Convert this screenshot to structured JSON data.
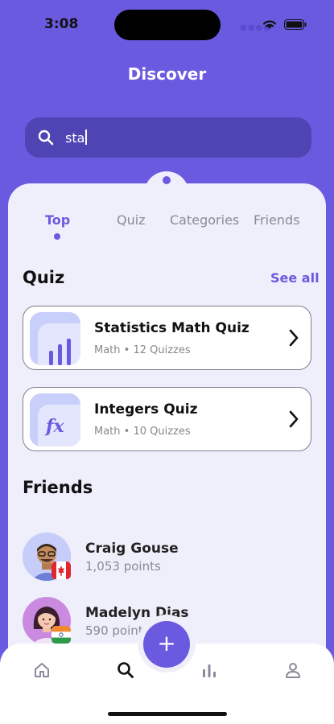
{
  "status": {
    "time": "3:08"
  },
  "header": {
    "title": "Discover"
  },
  "search": {
    "value": "sta"
  },
  "tabs": [
    {
      "label": "Top",
      "active": true
    },
    {
      "label": "Quiz",
      "active": false
    },
    {
      "label": "Categories",
      "active": false
    },
    {
      "label": "Friends",
      "active": false
    }
  ],
  "quiz_section": {
    "title": "Quiz",
    "see_all": "See all",
    "items": [
      {
        "name": "Statistics Math Quiz",
        "meta": "Math • 12 Quizzes",
        "icon": "bar-chart-icon"
      },
      {
        "name": "Integers Quiz",
        "meta": "Math • 10 Quizzes",
        "icon": "function-fx-icon",
        "icon_text": "fx"
      }
    ]
  },
  "friends_section": {
    "title": "Friends",
    "items": [
      {
        "name": "Craig Gouse",
        "points": "1,053 points",
        "flag": "canada-flag-icon"
      },
      {
        "name": "Madelyn Dias",
        "points": "590 points",
        "flag": "india-flag-icon"
      }
    ]
  },
  "fab": {
    "label": "+"
  },
  "tabbar": {
    "items": [
      "home-icon",
      "search-icon",
      "stats-icon",
      "profile-icon"
    ],
    "active": "search-icon"
  },
  "colors": {
    "accent": "#6A5AE0",
    "sheet": "#EFEEFB",
    "search_bg": "#4E44B4"
  }
}
